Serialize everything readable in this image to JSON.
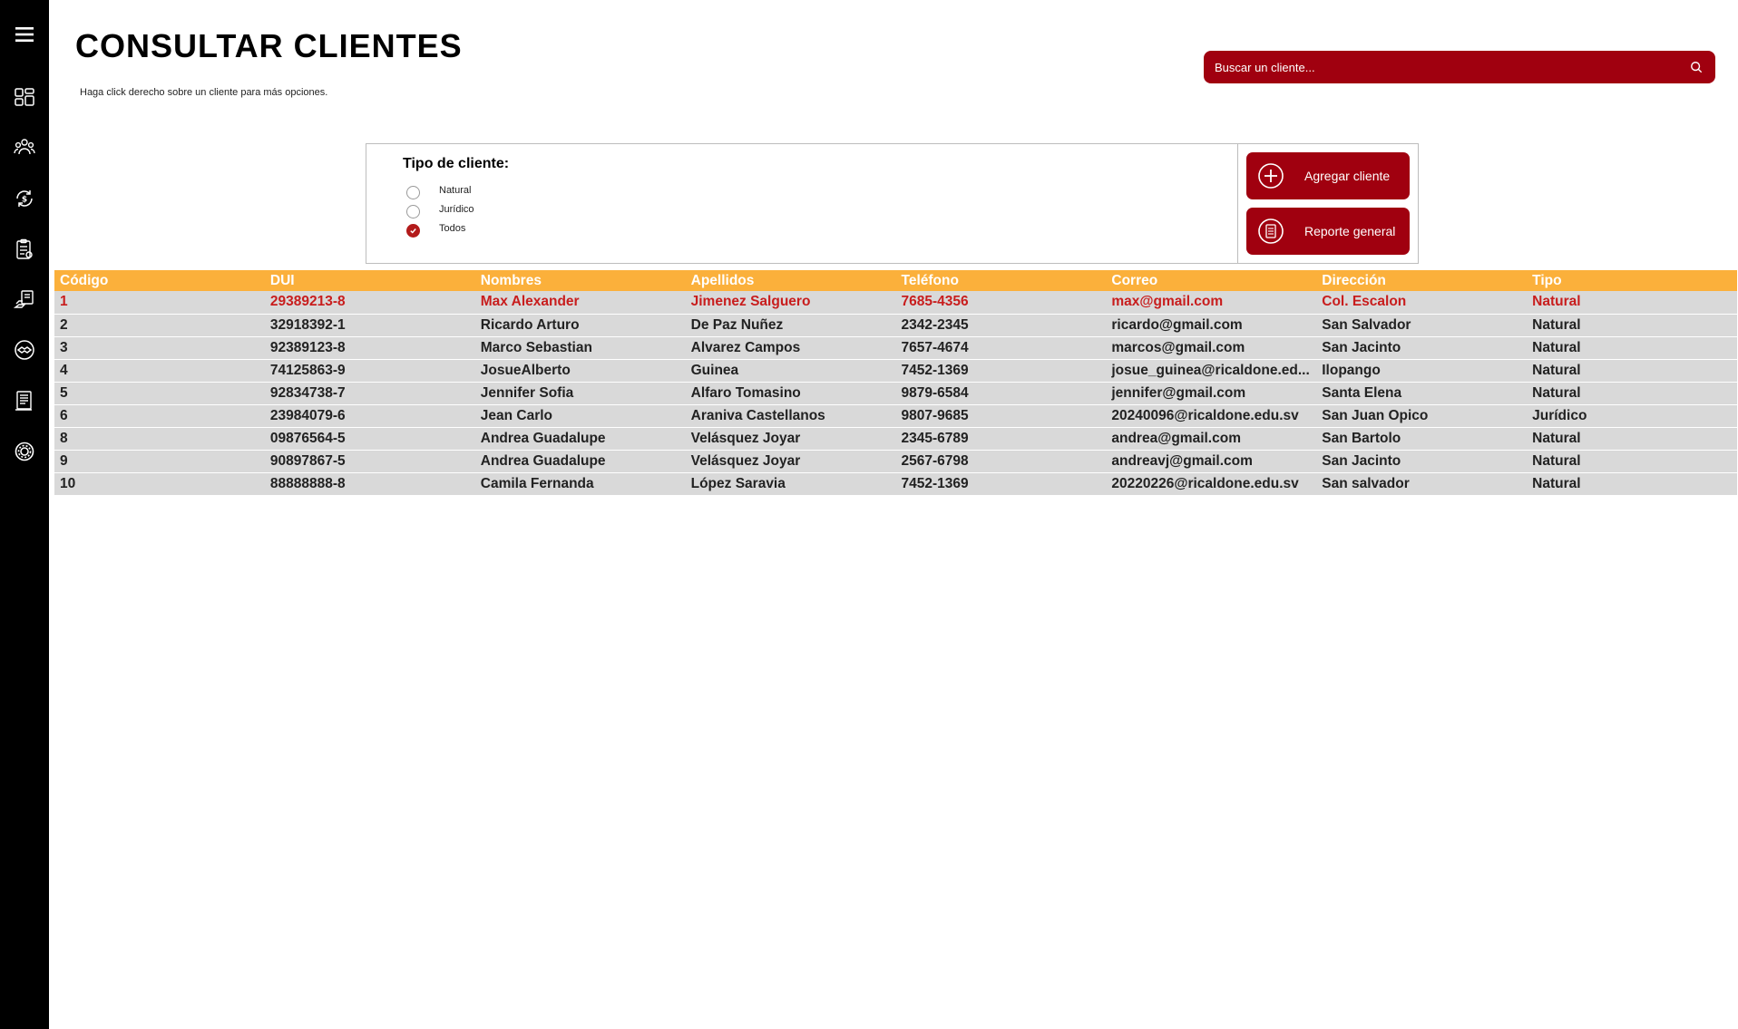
{
  "page": {
    "title": "CONSULTAR CLIENTES",
    "hint": "Haga click derecho sobre un cliente para más opciones."
  },
  "sidebar": {
    "items": [
      {
        "name": "menu-icon"
      },
      {
        "name": "dashboard-icon"
      },
      {
        "name": "clients-icon"
      },
      {
        "name": "sales-icon"
      },
      {
        "name": "inventory-icon"
      },
      {
        "name": "providers-icon"
      },
      {
        "name": "handshake-icon"
      },
      {
        "name": "reports-icon"
      },
      {
        "name": "settings-icon"
      }
    ]
  },
  "search": {
    "placeholder": "Buscar un cliente..."
  },
  "filter": {
    "title": "Tipo de cliente:",
    "options": [
      {
        "label": "Natural",
        "checked": false
      },
      {
        "label": "Jurídico",
        "checked": false
      },
      {
        "label": "Todos",
        "checked": true
      }
    ]
  },
  "actions": {
    "add_label": "Agregar cliente",
    "report_label": "Reporte general"
  },
  "table": {
    "headers": [
      "Código",
      "DUI",
      "Nombres",
      "Apellidos",
      "Teléfono",
      "Correo",
      "Dirección",
      "Tipo"
    ],
    "selected_index": 0,
    "rows": [
      [
        "1",
        "29389213-8",
        "Max Alexander",
        "Jimenez Salguero",
        "7685-4356",
        "max@gmail.com",
        "Col. Escalon",
        "Natural"
      ],
      [
        "2",
        "32918392-1",
        "Ricardo Arturo",
        "De Paz Nuñez",
        "2342-2345",
        "ricardo@gmail.com",
        "San Salvador",
        "Natural"
      ],
      [
        "3",
        "92389123-8",
        "Marco Sebastian",
        "Alvarez Campos",
        "7657-4674",
        "marcos@gmail.com",
        "San Jacinto",
        "Natural"
      ],
      [
        "4",
        "74125863-9",
        "JosueAlberto",
        "Guinea",
        "7452-1369",
        "josue_guinea@ricaldone.ed...",
        "Ilopango",
        "Natural"
      ],
      [
        "5",
        "92834738-7",
        "Jennifer Sofia",
        "Alfaro Tomasino",
        "9879-6584",
        "jennifer@gmail.com",
        "Santa Elena",
        "Natural"
      ],
      [
        "6",
        "23984079-6",
        "Jean Carlo",
        "Araniva Castellanos",
        "9807-9685",
        "20240096@ricaldone.edu.sv",
        "San Juan Opico",
        "Jurídico"
      ],
      [
        "8",
        "09876564-5",
        "Andrea Guadalupe",
        "Velásquez Joyar",
        "2345-6789",
        "andrea@gmail.com",
        "San Bartolo",
        "Natural"
      ],
      [
        "9",
        "90897867-5",
        "Andrea Guadalupe",
        "Velásquez Joyar",
        "2567-6798",
        "andreavj@gmail.com",
        "San Jacinto",
        "Natural"
      ],
      [
        "10",
        "88888888-8",
        "Camila Fernanda",
        "López Saravia",
        "7452-1369",
        "20220226@ricaldone.edu.sv",
        "San salvador",
        "Natural"
      ]
    ]
  },
  "colors": {
    "sidebar": "#000000",
    "brand_red": "#a0000f",
    "header_orange": "#fbb03b",
    "row_gray": "#d9d9d9",
    "selected_text": "#c81d1d"
  }
}
